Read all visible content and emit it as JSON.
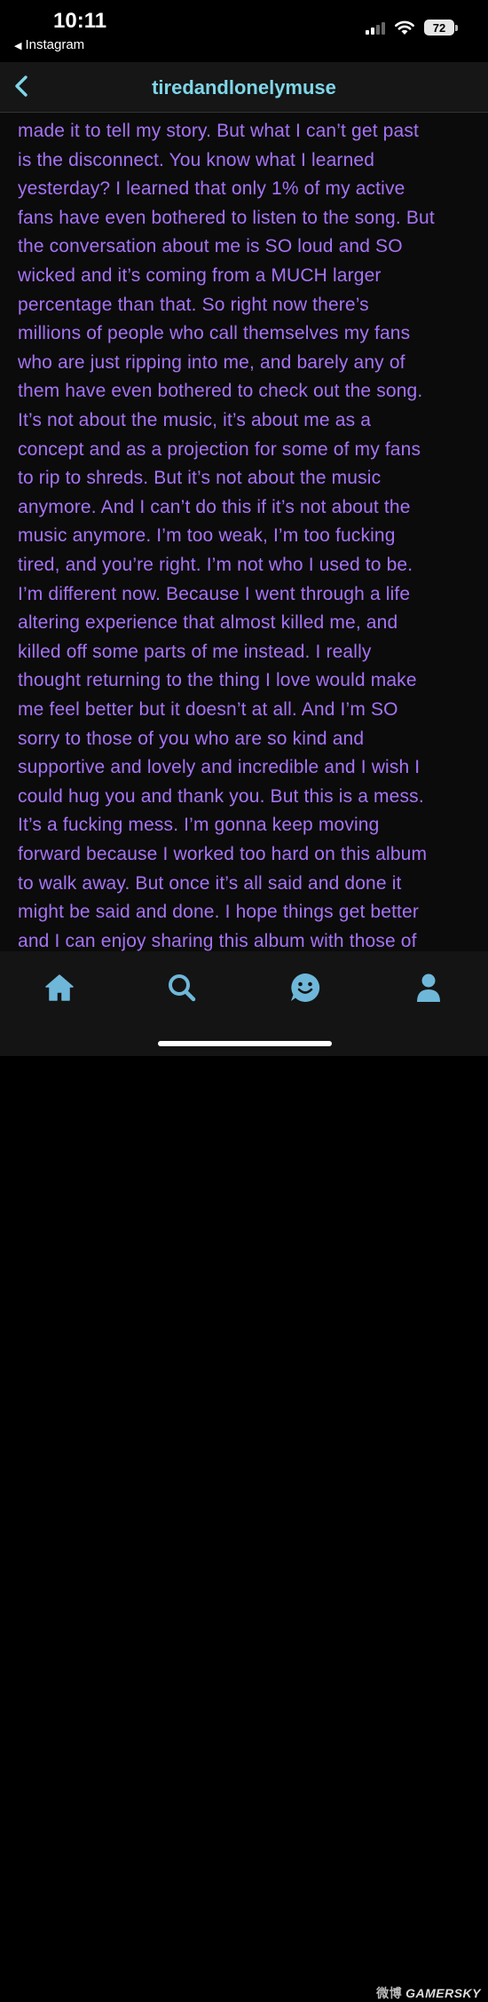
{
  "status_bar": {
    "time": "10:11",
    "back_app_label": "Instagram",
    "battery_level": "72",
    "signal_bars_active": 2,
    "icons": [
      "back-triangle-icon",
      "cellular-signal-icon",
      "wifi-icon",
      "battery-icon"
    ]
  },
  "header": {
    "title": "tiredandlonelymuse",
    "back_icon": "chevron-left-icon"
  },
  "post": {
    "lines": [
      "made it to tell my story. But what I can’t get past",
      "is the disconnect. You know what I learned",
      "yesterday? I learned that only 1% of my active",
      "fans have even bothered to listen to the song. But",
      "the conversation about me is SO loud and SO",
      "wicked and it’s coming from a MUCH larger",
      "percentage than that. So right now there’s",
      "millions of people who call themselves my fans",
      "who are just ripping into me, and barely any of",
      "them have even bothered to check out the song.",
      "It’s not about the music, it’s about me as a",
      "concept and as a projection for some of my fans",
      "to rip to shreds. But it’s not about the music",
      "anymore. And I can’t do this if it’s not about the",
      "music anymore. I’m too weak, I’m too fucking",
      "tired, and you’re right. I’m not who I used to be.",
      "I’m different now. Because I went through a life",
      "altering experience that almost killed me, and",
      "killed off some parts of me instead. I really",
      "thought returning to the thing I love would make",
      "me feel better but it doesn’t at all. And I’m SO",
      "sorry to those of you who are so kind and",
      "supportive and lovely and incredible and I wish I",
      "could hug you and thank you. But this is a mess.",
      "It’s a fucking mess. I’m gonna keep moving",
      "forward because I worked too hard on this album",
      "to walk away. But once it’s all said and done it",
      "might be said and done. I hope things get better",
      "and I can enjoy sharing this album with those of"
    ]
  },
  "tab_bar": {
    "tabs": [
      {
        "name": "home",
        "icon": "home-icon",
        "active": true
      },
      {
        "name": "search",
        "icon": "search-icon",
        "active": false
      },
      {
        "name": "messages",
        "icon": "chat-smiley-icon",
        "active": false
      },
      {
        "name": "profile",
        "icon": "person-icon",
        "active": false
      }
    ]
  },
  "watermark": {
    "prefix": "微博",
    "text": "GAMERSKY"
  },
  "colors": {
    "accent": "#7fd6e8",
    "post_text": "#a673f4",
    "background": "#0b0b0b",
    "header_bg": "#161616",
    "tab_bar_bg": "#141414",
    "tab_icon": "#6fb7d9"
  }
}
